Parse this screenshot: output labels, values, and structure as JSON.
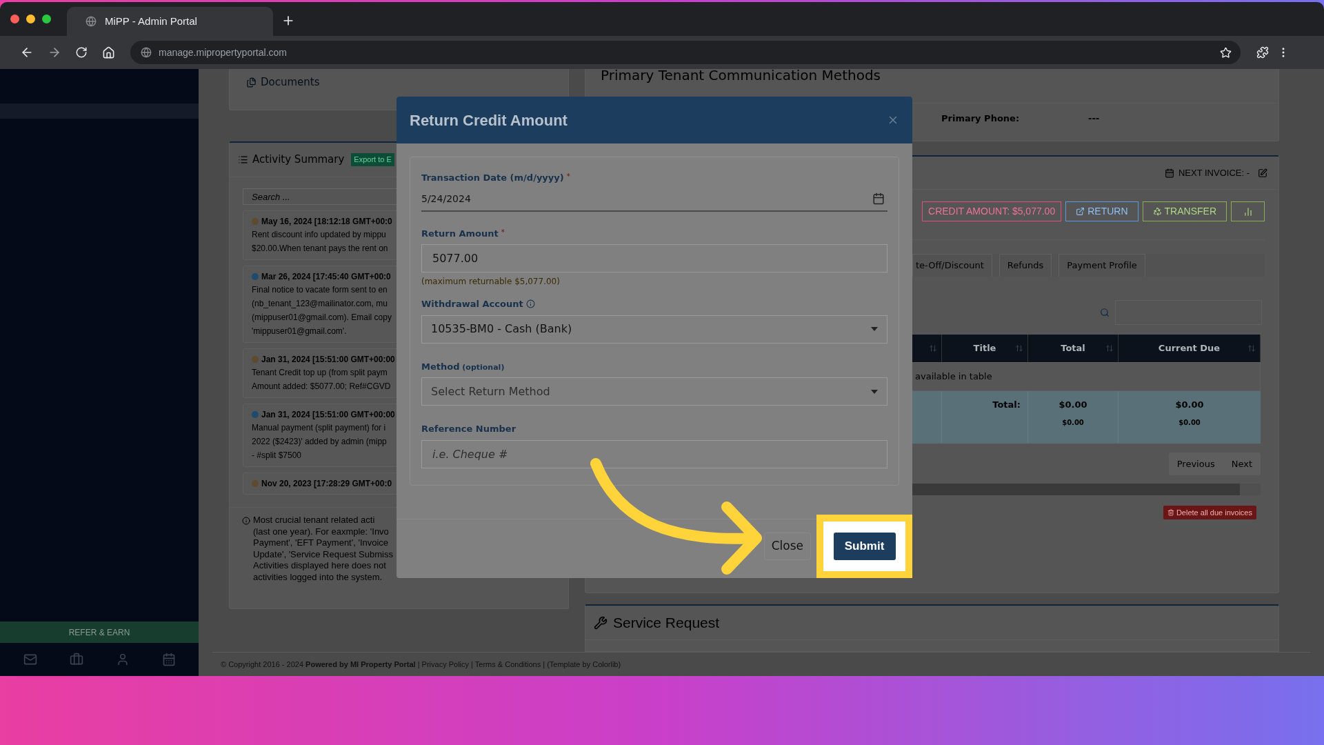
{
  "browser": {
    "tab_title": "MiPP - Admin Portal",
    "url": "manage.mipropertyportal.com"
  },
  "sidebar": {
    "refer_button": "REFER & EARN"
  },
  "documents_panel": {
    "title": "Documents"
  },
  "activity_summary": {
    "title": "Activity Summary",
    "export_button": "Export to E",
    "search_placeholder": "Search ...",
    "entries": [
      {
        "date": "May 16, 2024 [18:12:18 GMT+00:0",
        "text": "Rent discount info updated by mippu\n$20.00.When tenant pays the rent on",
        "color": "#5e4a2c"
      },
      {
        "date": "Mar 26, 2024 [17:45:40 GMT+00:0",
        "text": "Final notice to vacate form sent to en\n(nb_tenant_123@mailinator.com, mu\n(mippuser01@gmail.com). Email copy\n'mippuser01@gmail.com'.",
        "color": "#1f4a70"
      },
      {
        "date": "Jan 31, 2024 [15:51:00 GMT+00:00",
        "text": "Tenant Credit top up (from split paym\nAmount added: $5077.00; Ref#CGVD",
        "color": "#5e4a2c"
      },
      {
        "date": "Jan 31, 2024 [15:51:00 GMT+00:00",
        "text": "Manual payment (split payment) for i\n2022 ($2423)' added by admin (mipp\n- #split $7500",
        "color": "#1f4a70"
      },
      {
        "date": "Nov 20, 2023 [17:28:29 GMT+00:0",
        "color": "#5e4a2c"
      }
    ],
    "notice": "Most crucial tenant related acti\n(last one year). For eaxmple: 'Invo\nPayment', 'EFT Payment', 'Invoice\nUpdate', 'Service Request Submiss\nActivities displayed here does not\nactivities logged into the system."
  },
  "communication": {
    "title": "Primary Tenant Communication Methods",
    "fields": [
      {
        "label": "Primary Phone:",
        "value": "---"
      }
    ]
  },
  "invoice_panel": {
    "next_invoice": "NEXT INVOICE: -",
    "credit_amount": "CREDIT AMOUNT: $5,077.00",
    "return_button": "RETURN",
    "transfer_button": "TRANSFER",
    "tabs": [
      "te-Off/Discount",
      "Refunds",
      "Payment Profile"
    ],
    "table": {
      "columns": [
        "Title",
        "Total",
        "Current Due"
      ],
      "empty_message": "available in table",
      "total_label": "Total:",
      "totals": [
        {
          "main": "$0.00",
          "sub": "$0.00"
        },
        {
          "main": "$0.00",
          "sub": "$0.00"
        }
      ]
    },
    "pagination": [
      "Previous",
      "Next"
    ],
    "delete_button": "Delete all due invoices"
  },
  "service_request": {
    "title": "Service Request"
  },
  "footer": "© Copyright 2016 - 2024 **Powered by MI Property Portal** | Privacy Policy | Terms & Conditions | (Template by Colorlib)",
  "modal": {
    "title": "Return Credit Amount",
    "fields": [
      {
        "kind": "date",
        "label": "Transaction Date (m/d/yyyy)",
        "required_mark": "*",
        "value": "5/24/2024"
      },
      {
        "kind": "text",
        "label": "Return Amount",
        "required_mark": "*",
        "value": "5077.00",
        "hint": "(maximum returnable $5,077.00)"
      },
      {
        "kind": "select",
        "label": "Withdrawal Account",
        "info": true,
        "value": "10535-BM0 - Cash (Bank)"
      },
      {
        "kind": "select",
        "label": "Method",
        "label_note": "(optional)",
        "placeholder": "Select Return Method"
      },
      {
        "kind": "text",
        "label": "Reference Number",
        "placeholder": "i.e. Cheque #"
      }
    ],
    "buttons": [
      "Close",
      "Submit"
    ]
  }
}
